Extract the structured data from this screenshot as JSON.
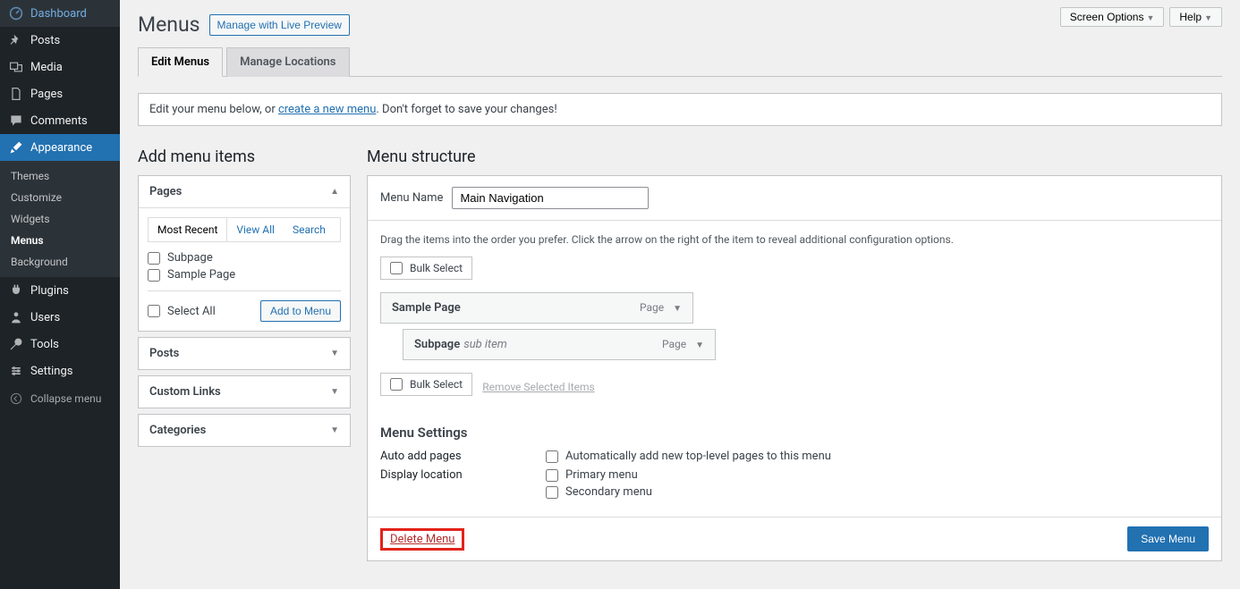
{
  "topbar": {
    "screen_options": "Screen Options",
    "help": "Help"
  },
  "page": {
    "title": "Menus",
    "live_preview": "Manage with Live Preview"
  },
  "tabs": {
    "edit": "Edit Menus",
    "locations": "Manage Locations"
  },
  "notice": {
    "before": "Edit your menu below, or ",
    "link": "create a new menu",
    "after": ". Don't forget to save your changes!"
  },
  "sidebar": {
    "items": [
      {
        "label": "Dashboard",
        "icon": "dashboard-icon"
      },
      {
        "label": "Posts",
        "icon": "pin-icon"
      },
      {
        "label": "Media",
        "icon": "media-icon"
      },
      {
        "label": "Pages",
        "icon": "pages-icon"
      },
      {
        "label": "Comments",
        "icon": "comments-icon"
      },
      {
        "label": "Appearance",
        "icon": "brush-icon"
      },
      {
        "label": "Plugins",
        "icon": "plugin-icon"
      },
      {
        "label": "Users",
        "icon": "users-icon"
      },
      {
        "label": "Tools",
        "icon": "tools-icon"
      },
      {
        "label": "Settings",
        "icon": "settings-icon"
      }
    ],
    "sub": [
      "Themes",
      "Customize",
      "Widgets",
      "Menus",
      "Background"
    ],
    "collapse": "Collapse menu"
  },
  "left": {
    "heading": "Add menu items",
    "pages": "Pages",
    "tabs": {
      "recent": "Most Recent",
      "view_all": "View All",
      "search": "Search"
    },
    "items": [
      "Subpage",
      "Sample Page"
    ],
    "select_all": "Select All",
    "add": "Add to Menu",
    "posts": "Posts",
    "custom": "Custom Links",
    "categories": "Categories"
  },
  "right": {
    "heading": "Menu structure",
    "name_label": "Menu Name",
    "name_value": "Main Navigation",
    "hint": "Drag the items into the order you prefer. Click the arrow on the right of the item to reveal additional configuration options.",
    "bulk": "Bulk Select",
    "remove": "Remove Selected Items",
    "items": [
      {
        "title": "Sample Page",
        "type": "Page"
      },
      {
        "title": "Subpage",
        "sub": "sub item",
        "type": "Page"
      }
    ],
    "settings_h": "Menu Settings",
    "auto_label": "Auto add pages",
    "auto_opt": "Automatically add new top-level pages to this menu",
    "loc_label": "Display location",
    "loc1": "Primary menu",
    "loc2": "Secondary menu",
    "delete": "Delete Menu",
    "save": "Save Menu"
  }
}
